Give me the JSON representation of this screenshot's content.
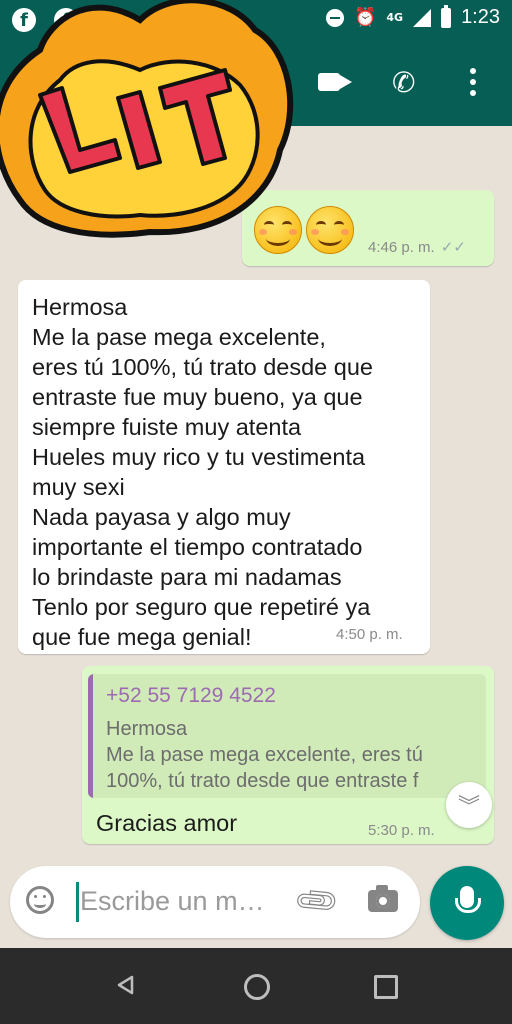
{
  "status_bar": {
    "time": "1:23",
    "network": "4G",
    "notification_icons": [
      "facebook-icon",
      "facebook-icon"
    ]
  },
  "app_bar": {
    "actions": [
      "video-call-icon",
      "call-icon",
      "more-options-icon"
    ]
  },
  "sticker": {
    "text": "LIT"
  },
  "messages": [
    {
      "type": "outgoing",
      "content": "😊😊",
      "time": "4:46 p. m.",
      "status": "read"
    },
    {
      "type": "incoming",
      "lines": [
        "Hermosa",
        "Me la pase mega excelente,",
        "eres tú 100%, tú trato desde que",
        "entraste fue muy bueno, ya que",
        "siempre fuiste muy atenta",
        "Hueles muy rico y tu vestimenta",
        "muy sexi",
        "Nada payasa y algo muy",
        "importante el tiempo contratado",
        "lo brindaste para mi nadamas",
        "Tenlo por seguro que repetiré ya",
        "que fue mega genial!"
      ],
      "time": "4:50 p. m."
    },
    {
      "type": "outgoing",
      "quote": {
        "sender": "+52 55 7129 4522",
        "lines": [
          "Hermosa",
          "Me la pase mega excelente, eres tú",
          "100%, tú trato desde que entraste f"
        ]
      },
      "text": "Gracias amor",
      "time": "5:30 p. m."
    }
  ],
  "composer": {
    "placeholder": "Escribe un m…"
  },
  "colors": {
    "header": "#075e54",
    "outgoing_bubble": "#dcf8c6",
    "incoming_bubble": "#ffffff",
    "quote_accent": "#9c6bb0",
    "send_button": "#00897b"
  }
}
